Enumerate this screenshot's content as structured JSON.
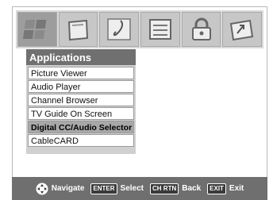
{
  "menu_bar": {
    "tabs": [
      {
        "icon": "picture-icon",
        "active": true
      },
      {
        "icon": "screen-icon",
        "active": false
      },
      {
        "icon": "music-note-icon",
        "active": false
      },
      {
        "icon": "list-icon",
        "active": false
      },
      {
        "icon": "lock-icon",
        "active": false
      },
      {
        "icon": "setup-icon",
        "active": false
      }
    ]
  },
  "panel": {
    "title": "Applications",
    "items": [
      "Picture Viewer",
      "Audio Player",
      "Channel Browser",
      "TV Guide On Screen",
      "Digital CC/Audio Selector",
      "CableCARD"
    ],
    "selected_index": 4
  },
  "footer": {
    "navigate_label": "Navigate",
    "enter_key": "ENTER",
    "select_label": "Select",
    "chrtn_key": "CH RTN",
    "back_label": "Back",
    "exit_key": "EXIT",
    "exit_label": "Exit"
  },
  "colors": {
    "header_bg": "#707070",
    "footer_bg": "#6f6f6f",
    "selected_bg": "#a8a8a8",
    "icon_bar_bg": "#d9d9d9"
  }
}
